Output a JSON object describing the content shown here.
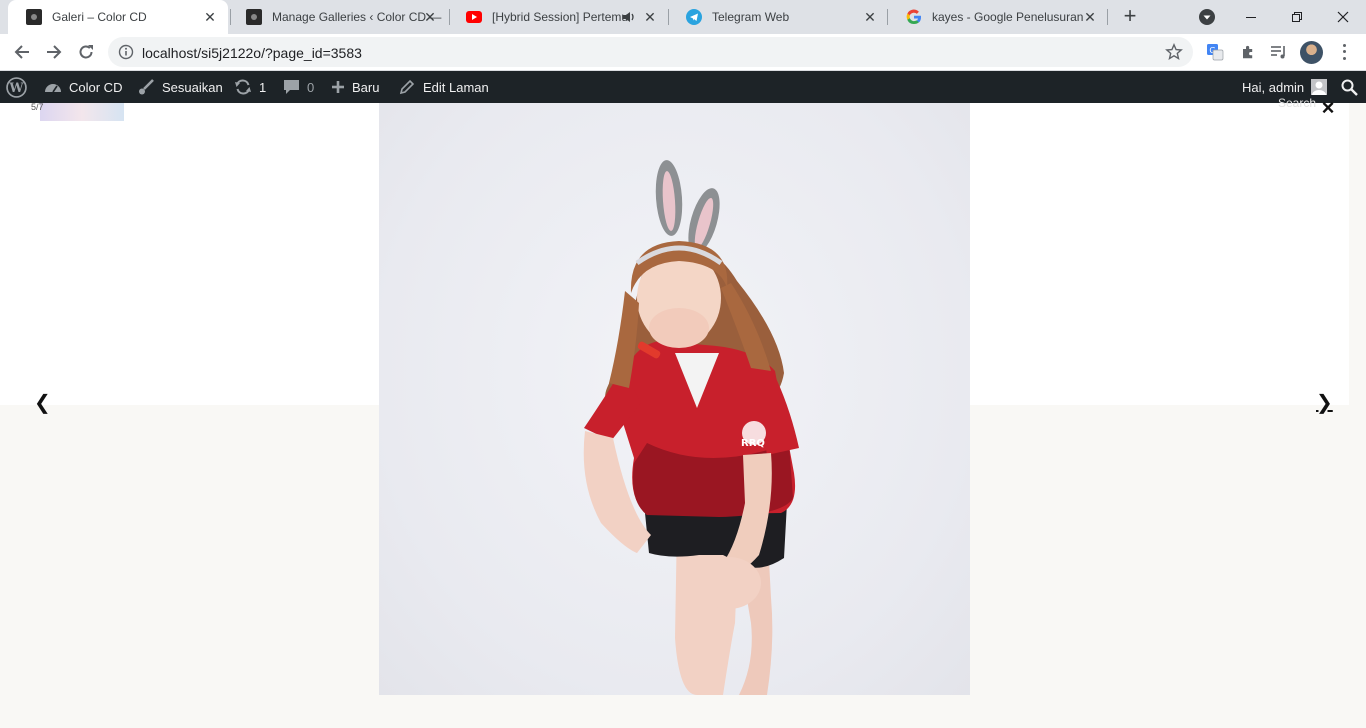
{
  "browser": {
    "tabs": [
      {
        "title": "Galeri – Color CD",
        "active": true
      },
      {
        "title": "Manage Galleries ‹ Color CD — ",
        "active": false
      },
      {
        "title": "[Hybrid Session] Pertemu",
        "active": false,
        "audio": true
      },
      {
        "title": "Telegram Web",
        "active": false
      },
      {
        "title": "kayes - Google Penelusuran",
        "active": false
      }
    ],
    "url": "localhost/si5j2122o/?page_id=3583"
  },
  "adminbar": {
    "site_name": "Color CD",
    "customize": "Sesuaikan",
    "updates_count": "1",
    "comments_count": "0",
    "new_label": "Baru",
    "edit_label": "Edit Laman",
    "greeting": "Hai, admin"
  },
  "lightbox": {
    "counter": "5/7",
    "search_placeholder": "Search",
    "close_symbol": "×",
    "prev_symbol": "❮",
    "next_symbol": "❯"
  },
  "colors": {
    "adminbar_bg": "#1d2327",
    "tabstrip_bg": "#dee1e6",
    "page_bg": "#f9f8f5",
    "jersey_red": "#c8202c"
  }
}
